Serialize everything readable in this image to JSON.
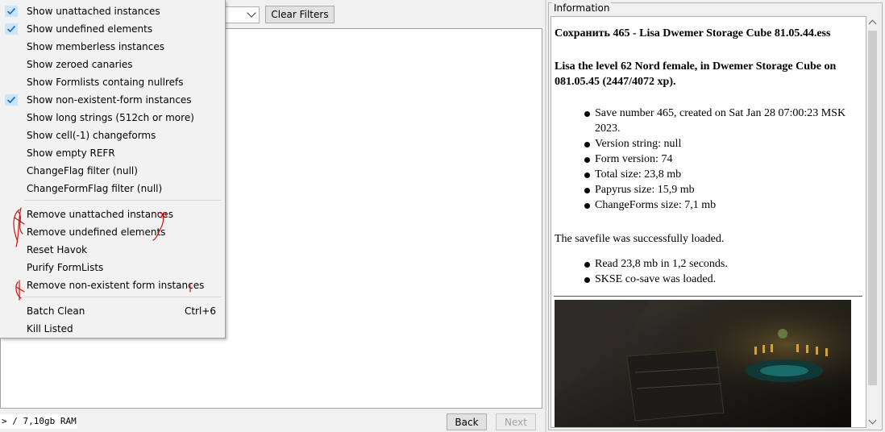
{
  "toolbar": {
    "clear_filters_label": "Clear Filters"
  },
  "status": {
    "memory_text": "> / 7,10gb RAM"
  },
  "nav": {
    "back_label": "Back",
    "next_label": "Next"
  },
  "menu": {
    "filter_items": [
      {
        "label": "Show unattached instances",
        "checked": true
      },
      {
        "label": "Show undefined elements",
        "checked": true
      },
      {
        "label": "Show memberless instances",
        "checked": false
      },
      {
        "label": "Show zeroed canaries",
        "checked": false
      },
      {
        "label": "Show Formlists containg nullrefs",
        "checked": false
      },
      {
        "label": "Show non-existent-form instances",
        "checked": true
      },
      {
        "label": "Show long strings (512ch or more)",
        "checked": false
      },
      {
        "label": "Show cell(-1) changeforms",
        "checked": false
      },
      {
        "label": "Show empty REFR",
        "checked": false
      },
      {
        "label": "ChangeFlag filter (null)",
        "checked": false
      },
      {
        "label": "ChangeFormFlag filter (null)",
        "checked": false
      }
    ],
    "clean_items": [
      {
        "label": "Remove unattached instances"
      },
      {
        "label": "Remove undefined elements"
      },
      {
        "label": "Reset Havok"
      },
      {
        "label": "Purify FormLists"
      },
      {
        "label": "Remove non-existent form instances"
      }
    ],
    "batch_clean_label": "Batch Clean",
    "batch_clean_shortcut": "Ctrl+6",
    "kill_listed_label": "Kill Listed"
  },
  "info": {
    "legend": "Information",
    "save_title": "Сохранить 465 - Lisa Dwemer Storage Cube 81.05.44.ess",
    "summary": "Lisa the level 62 Nord female, in Dwemer Storage Cube on 081.05.45 (2447/4072 xp).",
    "details": [
      "Save number 465, created on Sat Jan 28 07:00:23 MSK 2023.",
      "Version string: null",
      "Form version: 74",
      "Total size: 23,8 mb",
      "Papyrus size: 15,9 mb",
      "ChangeForms size: 7,1 mb"
    ],
    "loaded_message": "The savefile was successfully loaded.",
    "load_details": [
      "Read 23,8 mb in 1,2 seconds.",
      "SKSE co-save was loaded."
    ]
  },
  "colors": {
    "check": "#2a73c5",
    "annotation": "#d01010",
    "menu_bg": "#f2f2f2"
  }
}
